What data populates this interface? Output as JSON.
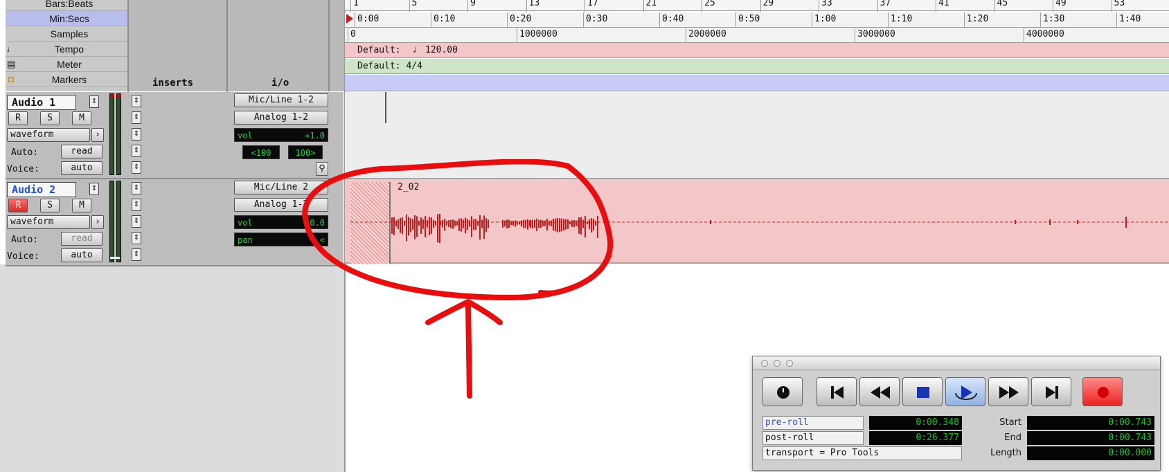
{
  "rulers": {
    "labels": [
      "Bars:Beats",
      "Min:Secs",
      "Samples",
      "Tempo",
      "Meter",
      "Markers"
    ],
    "inserts_header": "inserts",
    "io_header": "i/o",
    "bars": [
      "1",
      "5",
      "9",
      "13",
      "17",
      "21",
      "25",
      "29",
      "33",
      "37",
      "41",
      "45",
      "49",
      "53"
    ],
    "minsecs": [
      "0:00",
      "0:10",
      "0:20",
      "0:30",
      "0:40",
      "0:50",
      "1:00",
      "1:10",
      "1:20",
      "1:30",
      "1:40"
    ],
    "samples": [
      "0",
      "1000000",
      "2000000",
      "3000000",
      "4000000"
    ],
    "tempo_text": "Default:",
    "tempo_value": "120.00",
    "meter_text": "Default: 4/4"
  },
  "tracks": [
    {
      "name": "Audio 1",
      "r": "R",
      "s": "S",
      "m": "M",
      "view": "waveform",
      "auto_label": "Auto:",
      "auto_value": "read",
      "voice_label": "Voice:",
      "voice_value": "auto",
      "input": "Mic/Line 1-2",
      "output": "Analog 1-2",
      "vol_label": "vol",
      "vol_value": "+1.0",
      "pan_left": "<100",
      "pan_right": "100>"
    },
    {
      "name": "Audio 2",
      "r": "R",
      "s": "S",
      "m": "M",
      "view": "waveform",
      "auto_label": "Auto:",
      "auto_value": "read",
      "voice_label": "Voice:",
      "voice_value": "auto",
      "input": "Mic/Line 2",
      "output": "Analog 1-2",
      "vol_label": "vol",
      "vol_value": "0.0",
      "pan_label": "pan",
      "pan_value": "<"
    }
  ],
  "region": {
    "name": "2_02"
  },
  "transport": {
    "pre_roll_label": "pre-roll",
    "pre_roll_value": "0:00.348",
    "post_roll_label": "post-roll",
    "post_roll_value": "0:26.377",
    "mode": "transport = Pro Tools",
    "start_label": "Start",
    "start_value": "0:00.743",
    "end_label": "End",
    "end_value": "0:00.743",
    "length_label": "Length",
    "length_value": "0:00.000"
  },
  "colors": {
    "region_fill": "#f3c7c7",
    "waveform": "#c41b1b",
    "annotation": "#ea0d0d",
    "tempo_row": "#f3c7c9",
    "meter_row": "#cfe5c8",
    "markers_row": "#c9cbf7",
    "record_button": "#ef2b2b"
  }
}
